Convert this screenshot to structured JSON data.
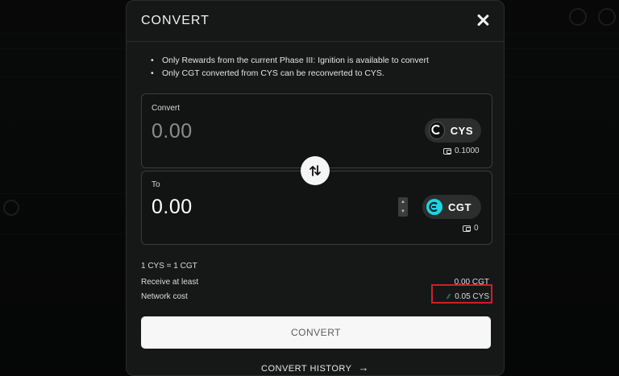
{
  "modal": {
    "title": "CONVERT",
    "notes": [
      "Only Rewards from the current Phase III: Ignition is available to convert",
      "Only CGT converted from CYS can be reconverted to CYS."
    ],
    "from": {
      "label": "Convert",
      "amount_placeholder": "0.00",
      "token": "CYS",
      "balance": "0.1000"
    },
    "to": {
      "label": "To",
      "amount": "0.00",
      "token": "CGT",
      "balance": "0"
    },
    "rate": "1 CYS = 1 CGT",
    "receive_label": "Receive at least",
    "receive_value": "0.00 CGT",
    "network_cost_label": "Network cost",
    "network_cost_value": "0.05 CYS",
    "convert_button": "CONVERT",
    "history_link": "CONVERT HISTORY"
  },
  "colors": {
    "accent_cyan": "#1bd6e4",
    "highlight_red": "#d21e26",
    "button_bg": "#f7f7f7"
  },
  "icons": [
    "close-icon",
    "swap-icon",
    "cys-logo-icon",
    "cgt-logo-icon",
    "wallet-icon",
    "gas-icon",
    "arrow-right-icon"
  ]
}
